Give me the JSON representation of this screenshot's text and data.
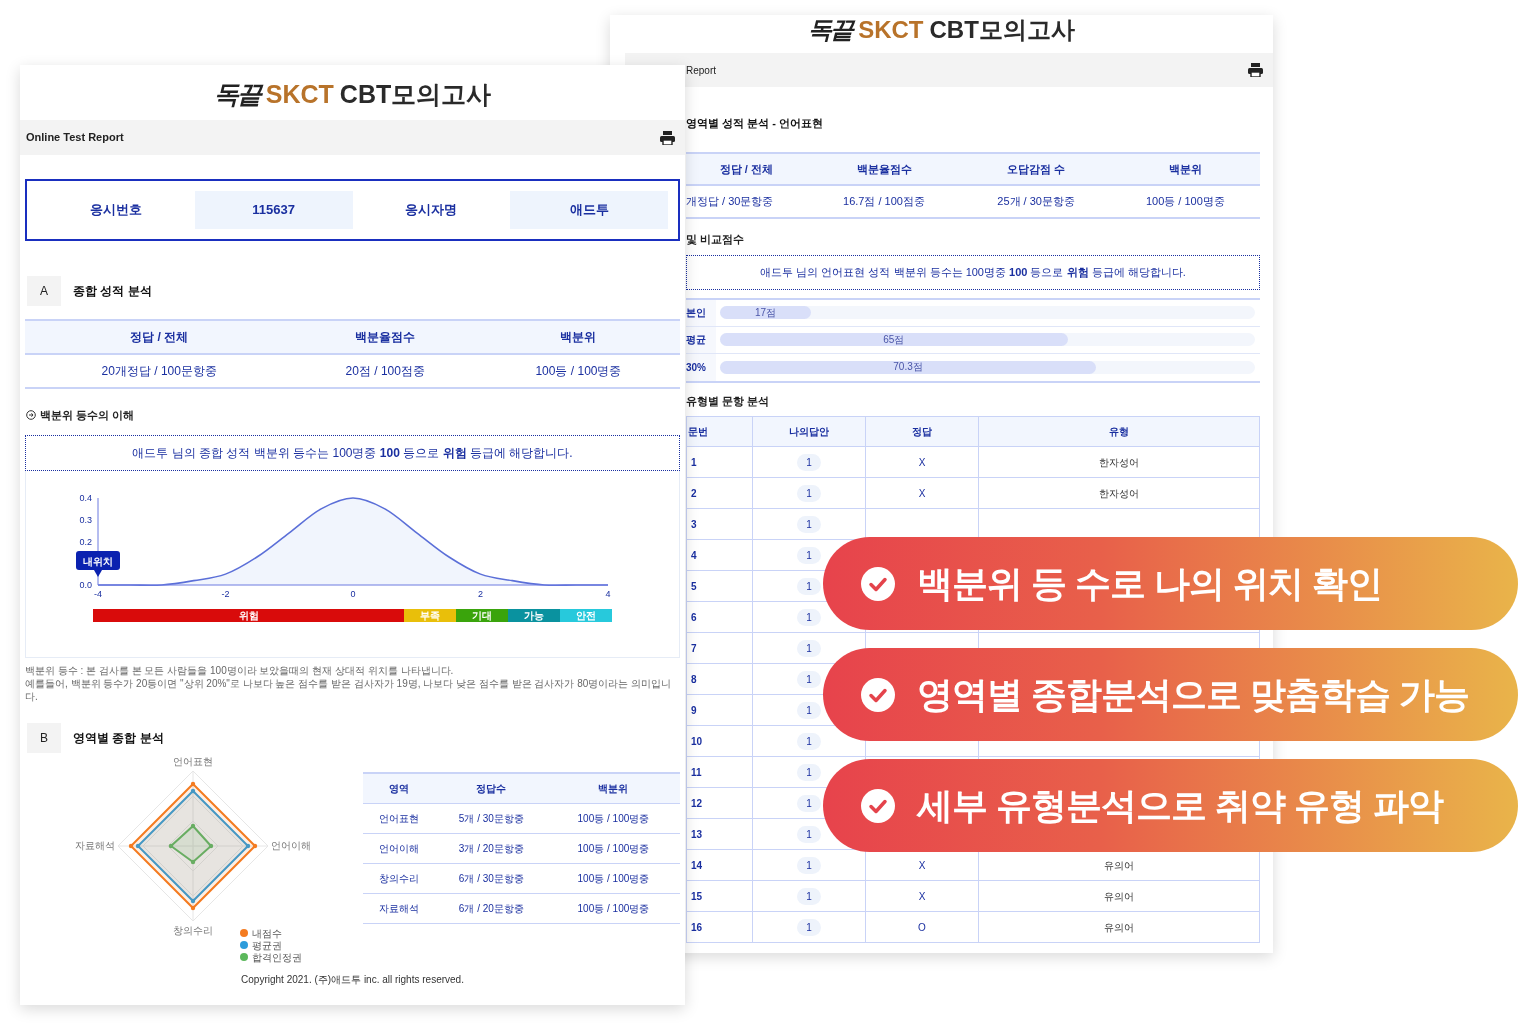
{
  "left_report": {
    "logo": {
      "mark": "독끝",
      "brand": "SKCT",
      "product": "CBT모의고사"
    },
    "header": "Online Test Report",
    "examinee": [
      {
        "label": "응시번호",
        "value": "115637"
      },
      {
        "label": "응시자명",
        "value": "애드투"
      }
    ],
    "section_a": {
      "letter": "A",
      "title": "종합 성적 분석",
      "table": {
        "columns": [
          "정답 / 전체",
          "백분율점수",
          "백분위"
        ],
        "rows": [
          [
            "20개정답 / 100문항중",
            "20점 / 100점중",
            "100등 / 100명중"
          ]
        ]
      }
    },
    "explanation": {
      "title": "백분위 등수의 이해",
      "sentence": "애드투 님의 종합 성적 백분위 등수는 100명중 **100** 등으로 **위험** 등급에 해당합니다.",
      "chart_data": {
        "type": "area",
        "x": [
          -4,
          -3.5,
          -3,
          -2.5,
          -2,
          -1.5,
          -1,
          -0.5,
          0,
          0.5,
          1,
          1.5,
          2,
          2.5,
          3,
          3.5,
          4
        ],
        "series": [
          {
            "color": "#5b6fd8",
            "values": [
              0,
              0,
              0,
              0.02,
              0.05,
              0.13,
              0.24,
              0.35,
              0.4,
              0.35,
              0.24,
              0.13,
              0.05,
              0.02,
              0,
              0,
              0
            ]
          }
        ],
        "xlim": [
          -4,
          4
        ],
        "ylim": [
          0,
          0.4
        ],
        "xticks": [
          -4,
          -2,
          0,
          2,
          4
        ],
        "yticks": [
          {
            "value": 0,
            "label": "0.0"
          },
          {
            "value": 0.2,
            "label": "0.2"
          },
          {
            "value": 0.3,
            "label": "0.3"
          },
          {
            "value": 0.4,
            "label": "0.4"
          }
        ],
        "annotations": [
          {
            "text": "내위치"
          }
        ]
      },
      "grades": [
        {
          "label": "위험",
          "color": "#d90b0b"
        },
        {
          "label": "부족",
          "color": "#e9bf0a"
        },
        {
          "label": "기대",
          "color": "#3aa40c"
        },
        {
          "label": "가능",
          "color": "#0a929f"
        },
        {
          "label": "안전",
          "color": "#27c9dc"
        }
      ],
      "notes": [
        "백분위 등수 : 본 검사를 본 모든 사람들을 100명이라 보았을때의 현재 상대적 위치를 나타냅니다.",
        "예를들어, 백분위 등수가 20등이면 \"상위 20%\"로 나보다 높은 점수를 받은 검사자가 19명, 나보다 낮은 점수를 받은 검사자가 80명이라는 의미입니다."
      ]
    },
    "section_b": {
      "letter": "B",
      "title": "영역별 종합 분석",
      "radar": {
        "axes": [
          "언어표현",
          "언어이해",
          "창의수리",
          "자료해석"
        ],
        "legend": [
          {
            "label": "내점수",
            "color": "#f47b20"
          },
          {
            "label": "평균권",
            "color": "#2d9cdb"
          },
          {
            "label": "합격인정권",
            "color": "#5cb85c"
          }
        ]
      },
      "table": {
        "columns": [
          "영역",
          "정답수",
          "백분위"
        ],
        "rows": [
          [
            "언어표현",
            "5개 / 30문항중",
            "100등 / 100명중"
          ],
          [
            "언어이해",
            "3개 / 20문항중",
            "100등 / 100명중"
          ],
          [
            "창의수리",
            "6개 / 30문항중",
            "100등 / 100명중"
          ],
          [
            "자료해석",
            "6개 / 20문항중",
            "100등 / 100명중"
          ]
        ]
      }
    },
    "copyright": "Copyright 2021. (주)애드투 inc. all rights reserved."
  },
  "right_report": {
    "logo": {
      "mark": "독끝",
      "brand": "SKCT",
      "product": "CBT모의고사"
    },
    "header": "Report",
    "title": "영역별 성적 분석 - 언어표현",
    "table": {
      "columns": [
        "정답 / 전체",
        "백분율점수",
        "오답감점 수",
        "백분위"
      ],
      "rows": [
        [
          "개정답 / 30문항중",
          "16.7점 / 100점중",
          "25개 / 30문항중",
          "100등 / 100명중"
        ]
      ]
    },
    "comparison": {
      "title": "및 비교점수",
      "sentence": "애드투 님의 언어표현 성적 백분위 등수는 100명중 **100** 등으로 **위험** 등급에 해당합니다.",
      "bars": [
        {
          "label": "본인",
          "reading": "17점",
          "level": 0.17
        },
        {
          "label": "평균",
          "reading": "65점",
          "level": 0.65
        },
        {
          "label": "30%",
          "reading": "70.3점",
          "level": 0.703
        }
      ]
    },
    "questions": {
      "title": "유형별 문항 분석",
      "columns": [
        "문번",
        "나의답안",
        "정답",
        "유형"
      ],
      "rows": [
        {
          "number": "1",
          "answer": "1",
          "correct": "X",
          "type": "한자성어"
        },
        {
          "number": "2",
          "answer": "1",
          "correct": "X",
          "type": "한자성어"
        },
        {
          "number": "3",
          "answer": "1"
        },
        {
          "number": "4",
          "answer": "1"
        },
        {
          "number": "5",
          "answer": "1"
        },
        {
          "number": "6",
          "answer": "1"
        },
        {
          "number": "7",
          "answer": "1"
        },
        {
          "number": "8",
          "answer": "1"
        },
        {
          "number": "9",
          "answer": "1"
        },
        {
          "number": "10",
          "answer": "1"
        },
        {
          "number": "11",
          "answer": "1"
        },
        {
          "number": "12",
          "answer": "1"
        },
        {
          "number": "13",
          "answer": "1"
        },
        {
          "number": "14",
          "answer": "1",
          "correct": "X",
          "type": "유의어"
        },
        {
          "number": "15",
          "answer": "1",
          "correct": "X",
          "type": "유의어"
        },
        {
          "number": "16",
          "answer": "1",
          "correct": "O",
          "type": "유의어"
        }
      ]
    }
  },
  "banners": [
    {
      "text": "백분위 등 수로 나의 위치 확인"
    },
    {
      "text": "영역별 종합분석으로 맞춤학습 가능"
    },
    {
      "text": "세부 유형분석으로 취약 유형 파악"
    }
  ]
}
